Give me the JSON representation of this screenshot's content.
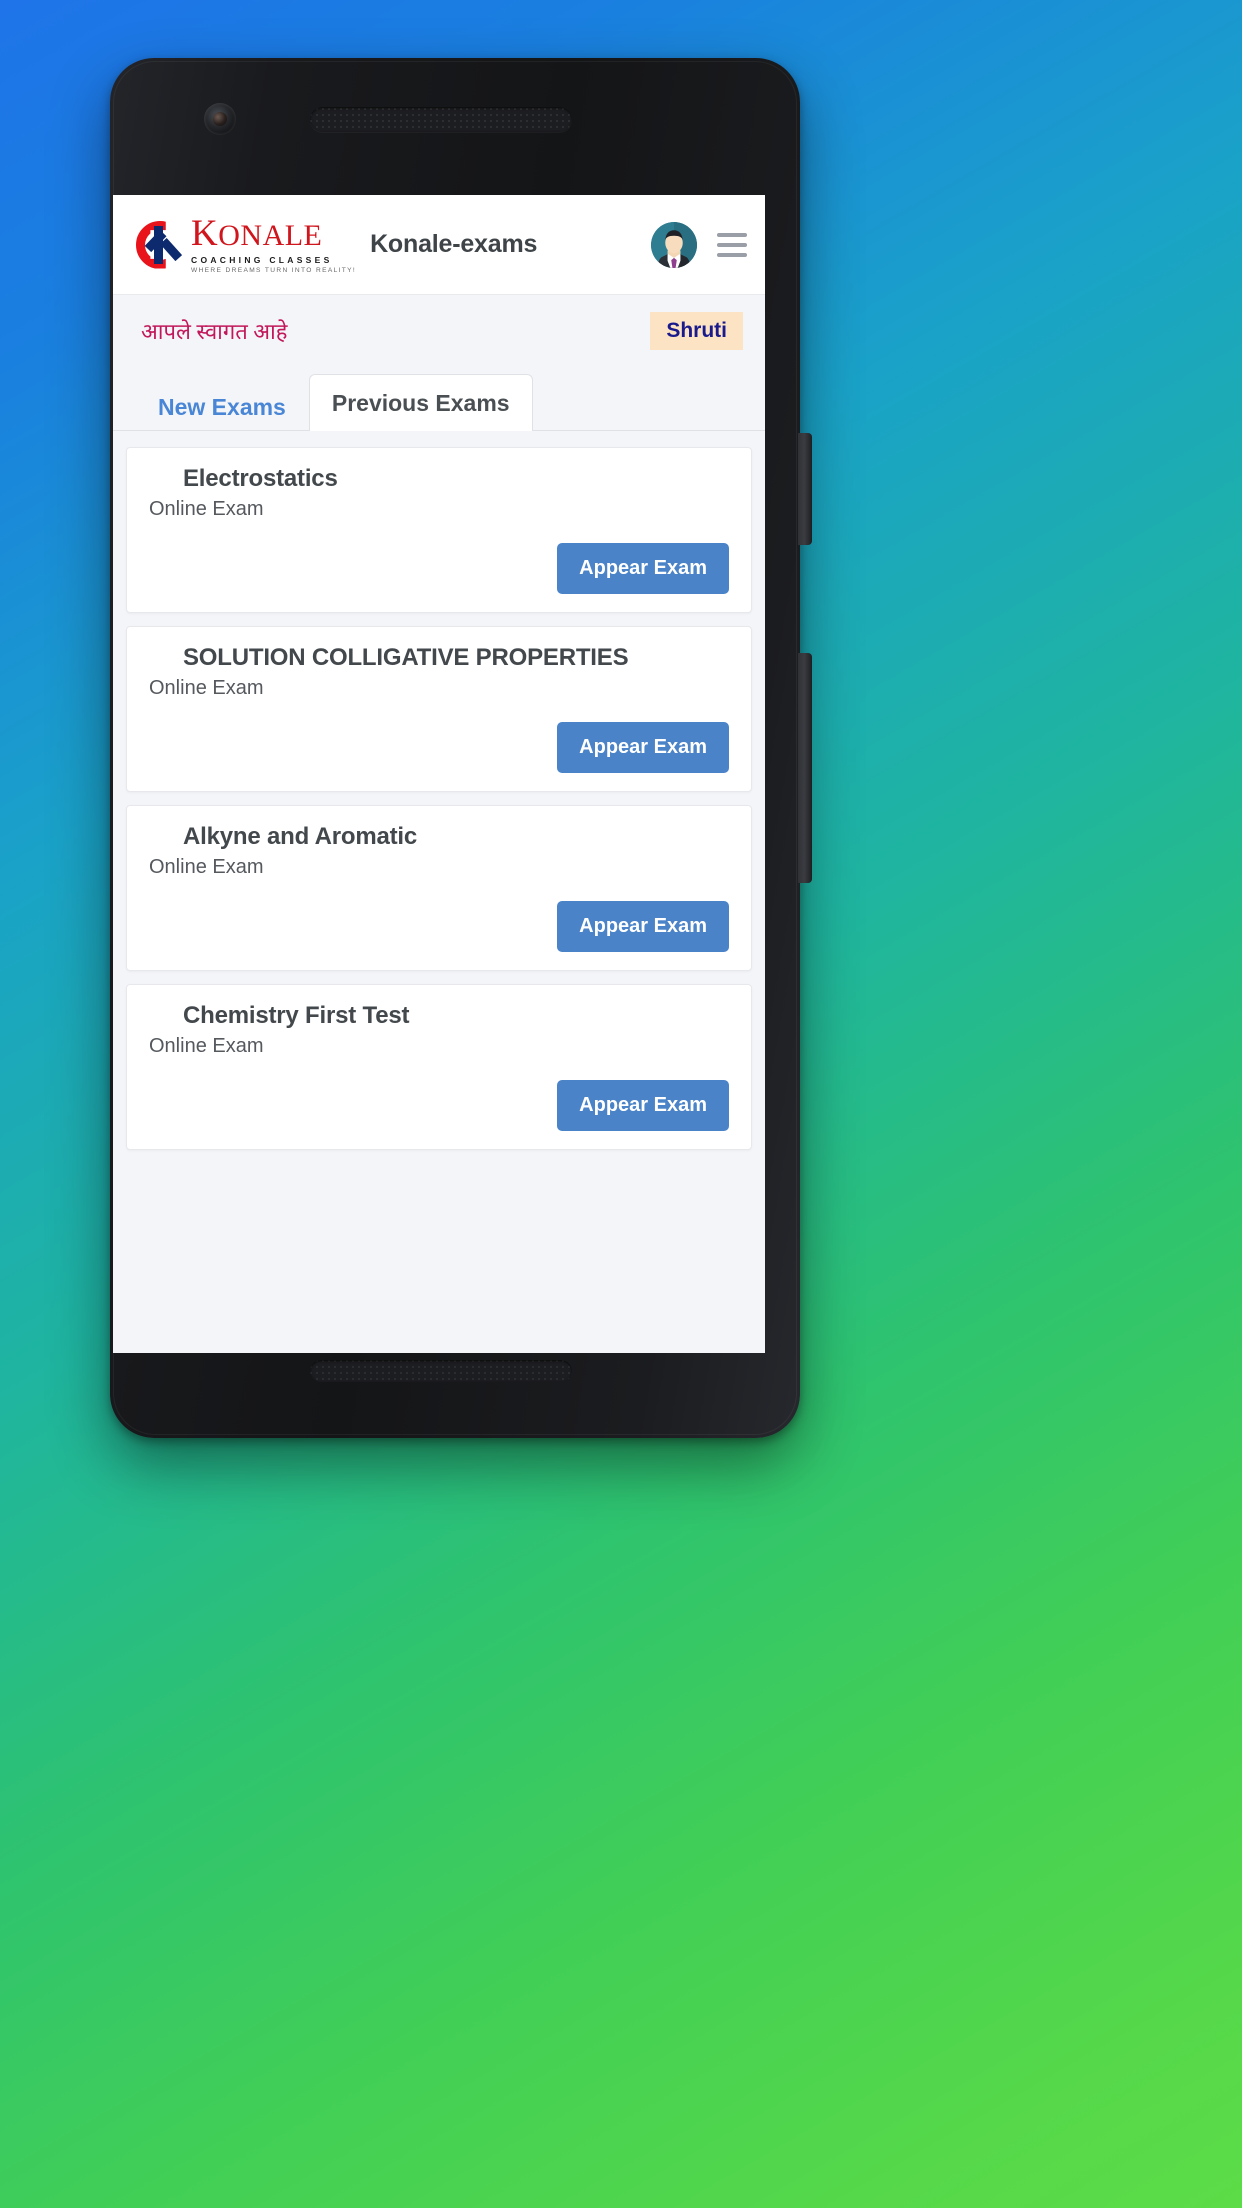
{
  "device": {
    "camera_icon": "front-camera-icon",
    "earpiece_icon": "earpiece-speaker-icon",
    "bottom_speaker_icon": "bottom-speaker-icon",
    "power_button": "power-button",
    "volume_button": "volume-rocker-button"
  },
  "appbar": {
    "logo": {
      "name": "KONALE",
      "tagline1": "COACHING CLASSES",
      "tagline2": "WHERE DREAMS TURN INTO REALITY!",
      "mark_icon": "konale-k-logo-icon",
      "brand_red": "#d0151c",
      "brand_navy": "#0e2a6e"
    },
    "title": "Konale-exams",
    "avatar_icon": "user-avatar-icon",
    "menu_icon": "hamburger-menu-icon"
  },
  "welcome": {
    "message": "आपले स्वागत आहे",
    "message_color": "#c2185b",
    "user_name": "Shruti",
    "badge_bg": "#fbe3c4",
    "badge_color": "#1a1a8c"
  },
  "tabs": [
    {
      "label": "New Exams",
      "active": false
    },
    {
      "label": "Previous Exams",
      "active": true
    }
  ],
  "exams": [
    {
      "title": "Electrostatics",
      "mode": "Online Exam",
      "action": "Appear Exam"
    },
    {
      "title": "SOLUTION COLLIGATIVE PROPERTIES",
      "mode": "Online Exam",
      "action": "Appear Exam"
    },
    {
      "title": "Alkyne and Aromatic",
      "mode": "Online Exam",
      "action": "Appear Exam"
    },
    {
      "title": "Chemistry First Test",
      "mode": "Online Exam",
      "action": "Appear Exam"
    }
  ],
  "theme": {
    "button_blue": "#4a83c8",
    "tab_link_blue": "#4a86d6",
    "page_bg": "#f4f5f9"
  }
}
